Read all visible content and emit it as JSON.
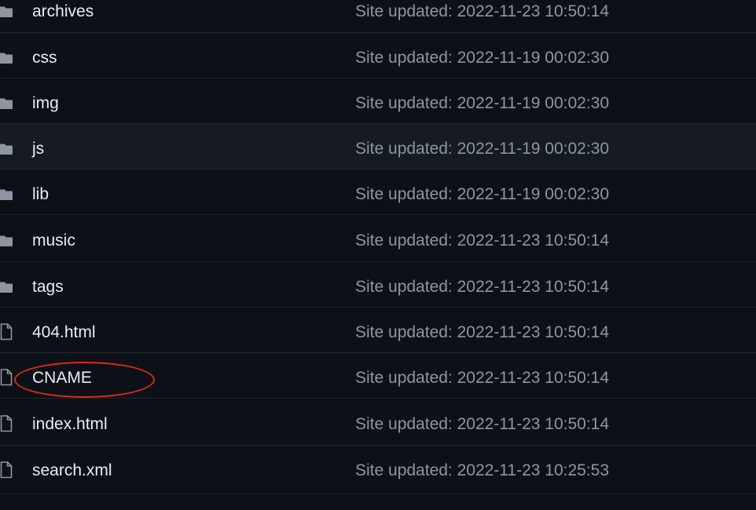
{
  "highlight_color": "#e2281f",
  "files": [
    {
      "name": "archives",
      "type": "folder",
      "message": "Site updated: 2022-11-23 10:50:14"
    },
    {
      "name": "css",
      "type": "folder",
      "message": "Site updated: 2022-11-19 00:02:30"
    },
    {
      "name": "img",
      "type": "folder",
      "message": "Site updated: 2022-11-19 00:02:30"
    },
    {
      "name": "js",
      "type": "folder",
      "message": "Site updated: 2022-11-19 00:02:30"
    },
    {
      "name": "lib",
      "type": "folder",
      "message": "Site updated: 2022-11-19 00:02:30"
    },
    {
      "name": "music",
      "type": "folder",
      "message": "Site updated: 2022-11-23 10:50:14"
    },
    {
      "name": "tags",
      "type": "folder",
      "message": "Site updated: 2022-11-23 10:50:14"
    },
    {
      "name": "404.html",
      "type": "file",
      "message": "Site updated: 2022-11-23 10:50:14"
    },
    {
      "name": "CNAME",
      "type": "file",
      "message": "Site updated: 2022-11-23 10:50:14"
    },
    {
      "name": "index.html",
      "type": "file",
      "message": "Site updated: 2022-11-23 10:50:14"
    },
    {
      "name": "search.xml",
      "type": "file",
      "message": "Site updated: 2022-11-23 10:25:53"
    }
  ]
}
